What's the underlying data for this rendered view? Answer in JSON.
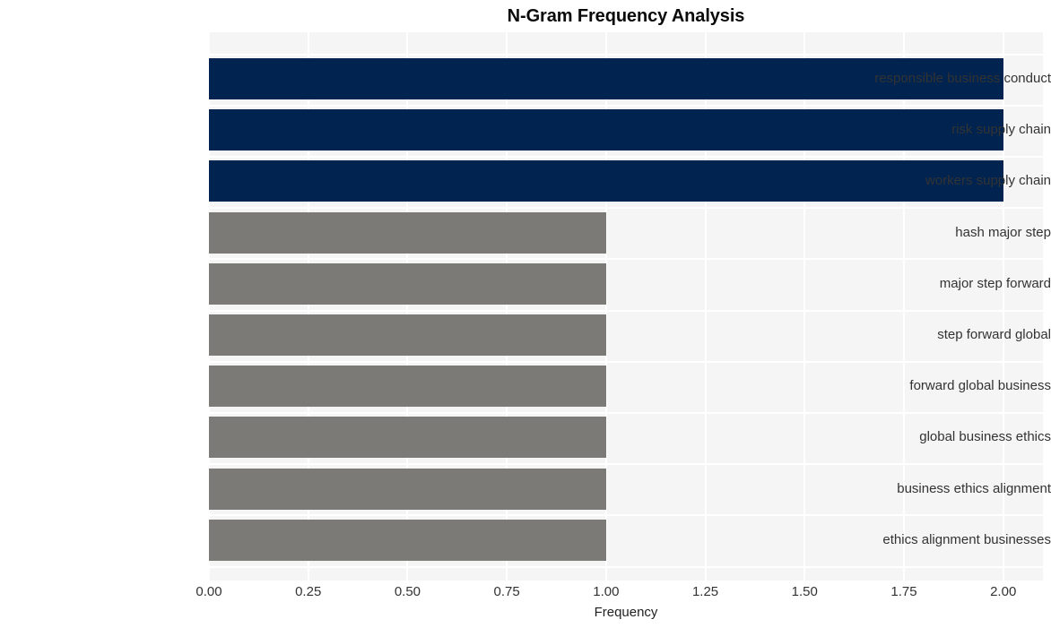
{
  "chart_data": {
    "type": "bar",
    "orientation": "horizontal",
    "title": "N-Gram Frequency Analysis",
    "xlabel": "Frequency",
    "ylabel": "",
    "categories": [
      "responsible business conduct",
      "risk supply chain",
      "workers supply chain",
      "hash major step",
      "major step forward",
      "step forward global",
      "forward global business",
      "global business ethics",
      "business ethics alignment",
      "ethics alignment businesses"
    ],
    "values": [
      2,
      2,
      2,
      1,
      1,
      1,
      1,
      1,
      1,
      1
    ],
    "bar_colors": [
      "#00244f",
      "#00244f",
      "#00244f",
      "#7b7a77",
      "#7b7a77",
      "#7b7a77",
      "#7b7a77",
      "#7b7a77",
      "#7b7a77",
      "#7b7a77"
    ],
    "xlim": [
      0,
      2.1
    ],
    "xticks": [
      0,
      0.25,
      0.5,
      0.75,
      1,
      1.25,
      1.5,
      1.75,
      2
    ],
    "xtick_labels": [
      "0.00",
      "0.25",
      "0.50",
      "0.75",
      "1.00",
      "1.25",
      "1.50",
      "1.75",
      "2.00"
    ],
    "grid": true,
    "grid_axis": "both",
    "grid_color": "#ffffff",
    "plot_background": "#f5f5f6",
    "figure_background": "#ffffff",
    "legend": null
  }
}
